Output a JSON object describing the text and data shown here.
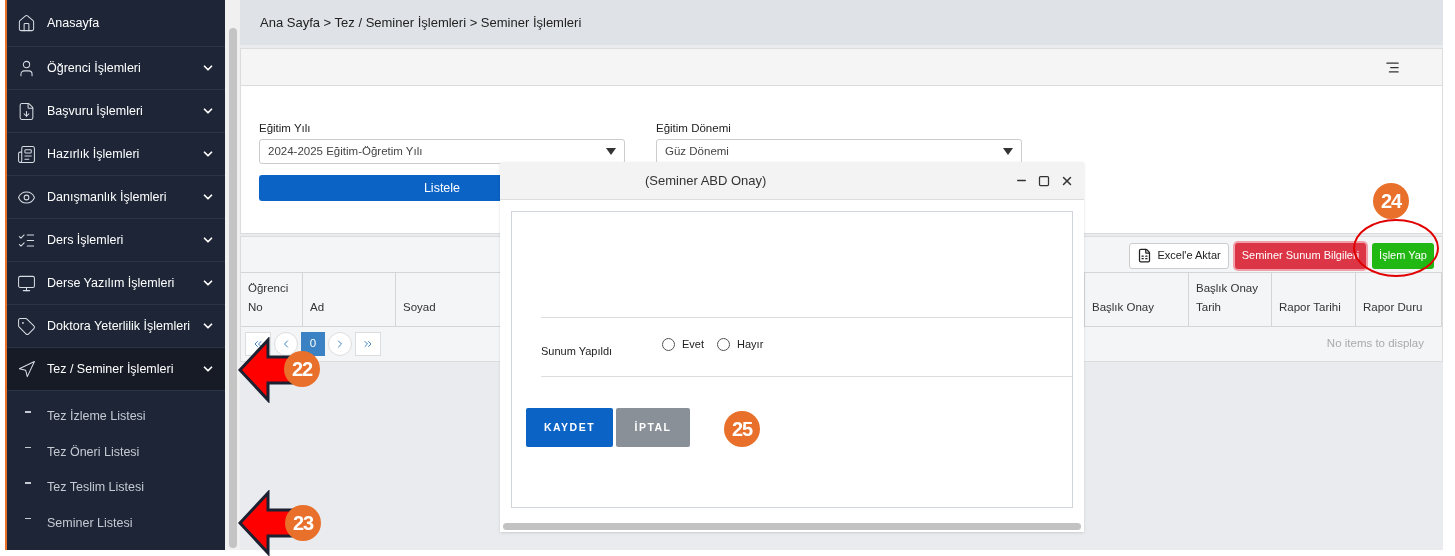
{
  "sidebar": {
    "items": [
      {
        "label": "Anasayfa",
        "kind": "link"
      },
      {
        "label": "Öğrenci İşlemleri",
        "kind": "menu",
        "expanded": false
      },
      {
        "label": "Başvuru İşlemleri",
        "kind": "menu",
        "expanded": false
      },
      {
        "label": "Hazırlık İşlemleri",
        "kind": "menu",
        "expanded": false
      },
      {
        "label": "Danışmanlık İşlemleri",
        "kind": "menu",
        "expanded": false
      },
      {
        "label": "Ders İşlemleri",
        "kind": "menu",
        "expanded": false
      },
      {
        "label": "Derse Yazılım İşlemleri",
        "kind": "menu",
        "expanded": false
      },
      {
        "label": "Doktora Yeterlilik İşlemleri",
        "kind": "menu",
        "expanded": false
      },
      {
        "label": "Tez / Seminer İşlemleri",
        "kind": "menu",
        "expanded": true,
        "children": [
          {
            "label": "Tez İzleme Listesi"
          },
          {
            "label": "Tez Öneri Listesi"
          },
          {
            "label": "Tez Teslim Listesi"
          },
          {
            "label": "Seminer Listesi"
          }
        ]
      }
    ]
  },
  "breadcrumb": "Ana Sayfa > Tez / Seminer İşlemleri > Seminer İşlemleri",
  "filters": [
    {
      "label": "Eğitim Yılı",
      "value": "2024-2025 Eğitim-Öğretim Yılı"
    },
    {
      "label": "Eğitim Dönemi",
      "value": "Güz Dönemi"
    }
  ],
  "list_button": "Listele",
  "grid": {
    "toolbar_buttons": [
      {
        "label": "Excel'e Aktar",
        "kind": "excel"
      },
      {
        "label": "Seminer Sunum Bilgileri",
        "kind": "danger"
      },
      {
        "label": "İşlem Yap",
        "kind": "success"
      }
    ],
    "columns": [
      "Öğrenci No",
      "Ad",
      "Soyad",
      "Başlık Onay",
      "Başlık Onay Tarih",
      "Rapor Tarihi",
      "Rapor Duru"
    ],
    "pager": {
      "page": "0"
    },
    "empty_message": "No items to display"
  },
  "modal": {
    "title": "(Seminer ABD Onay)",
    "field_label": "Sunum Yapıldı",
    "options": [
      {
        "label": "Evet",
        "selected": false
      },
      {
        "label": "Hayır",
        "selected": false
      }
    ],
    "buttons": [
      {
        "label": "KAYDET",
        "kind": "primary"
      },
      {
        "label": "İPTAL",
        "kind": "secondary"
      }
    ]
  },
  "annotations": [
    {
      "number": "22",
      "kind": "arrow"
    },
    {
      "number": "23",
      "kind": "arrow"
    },
    {
      "number": "24",
      "kind": "ellipse"
    },
    {
      "number": "25",
      "kind": "badge"
    }
  ]
}
